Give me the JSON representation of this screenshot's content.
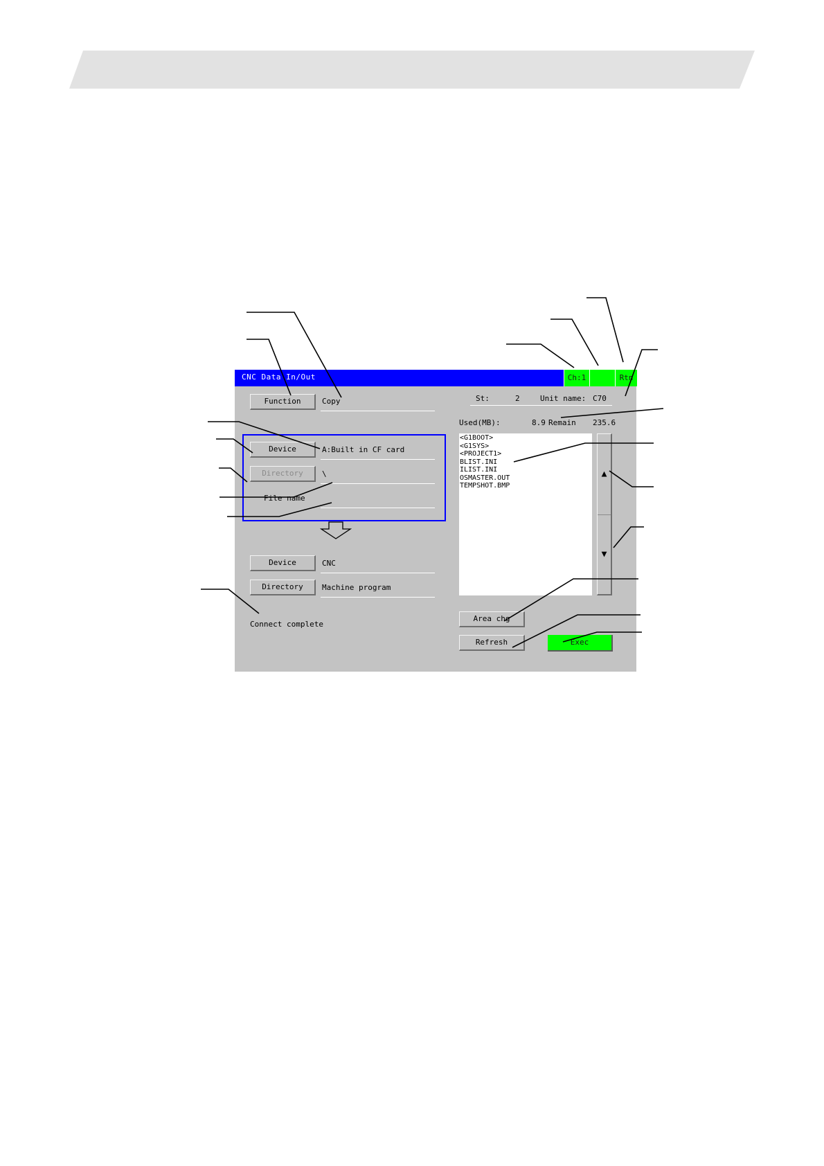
{
  "window": {
    "title": "CNC Data In/Out"
  },
  "titlebar_boxes": [
    {
      "label": "Ch:1"
    },
    {
      "label": ""
    },
    {
      "label": "Rtn"
    }
  ],
  "function": {
    "button": "Function",
    "value": "Copy"
  },
  "source": {
    "device_button": "Device",
    "device_value": "A:Built in CF card",
    "directory_button": "Directory",
    "directory_value": "\\",
    "filename_label": "File name",
    "filename_value": ""
  },
  "destination": {
    "device_button": "Device",
    "device_value": "CNC",
    "directory_button": "Directory",
    "directory_value": "Machine program"
  },
  "status": {
    "message": "Connect complete"
  },
  "station": {
    "st_label": "St:",
    "st_value": "2",
    "unit_label": "Unit name:",
    "unit_value": "C70"
  },
  "memory": {
    "used_label": "Used(MB):",
    "used_value": "8.9",
    "remain_label": "Remain",
    "remain_value": "235.6"
  },
  "files": [
    "<G1BOOT>",
    "<G1SYS>",
    "<PROJECT1>",
    "BLIST.INI",
    "ILIST.INI",
    "OSMASTER.OUT",
    "TEMPSHOT.BMP"
  ],
  "scroll": {
    "up": "▲",
    "down": "▼"
  },
  "buttons": {
    "area_chg": "Area chg",
    "refresh": "Refresh",
    "exec": "Exec"
  }
}
